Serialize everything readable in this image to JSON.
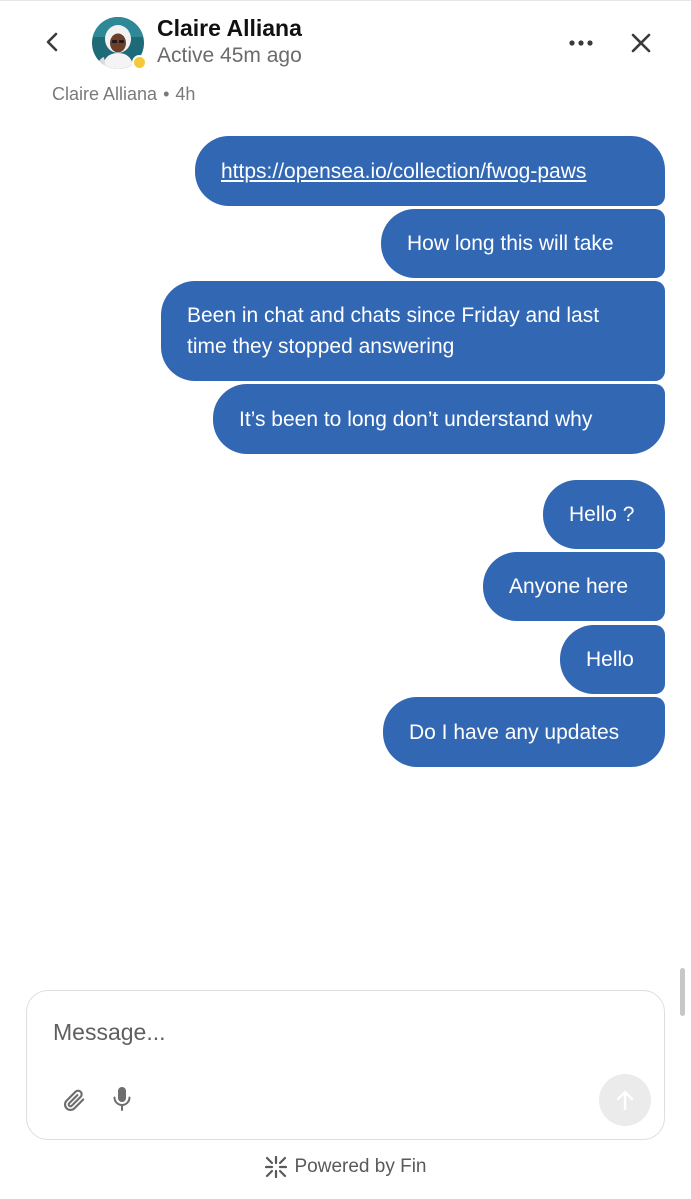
{
  "header": {
    "back_icon": "chevron-left-icon",
    "contact_name": "Claire Alliana",
    "contact_status": "Active 45m ago",
    "presence_color": "#f5c83b",
    "more_icon": "more-horizontal-icon",
    "close_icon": "close-icon"
  },
  "thread": {
    "sender": "Claire Alliana",
    "separator": "•",
    "time": "4h"
  },
  "messages": [
    {
      "text": "https://opensea.io/collection/fwog-paws",
      "is_link": true
    },
    {
      "text": "How long this will take"
    },
    {
      "text": "Been in chat and chats since Friday and last time they stopped answering"
    },
    {
      "text": "It’s been to long don’t understand why"
    },
    {
      "text": "Hello ?"
    },
    {
      "text": "Anyone here"
    },
    {
      "text": "Hello"
    },
    {
      "text": "Do I have any updates"
    }
  ],
  "composer": {
    "placeholder": "Message...",
    "value": "",
    "attach_icon": "paperclip-icon",
    "mic_icon": "microphone-icon",
    "send_icon": "arrow-up-icon"
  },
  "footer": {
    "powered_by": "Powered by Fin",
    "logo_icon": "fin-logo-icon"
  },
  "colors": {
    "bubble": "#3267b4",
    "bubble_text": "#ffffff",
    "background": "#ffffff"
  }
}
